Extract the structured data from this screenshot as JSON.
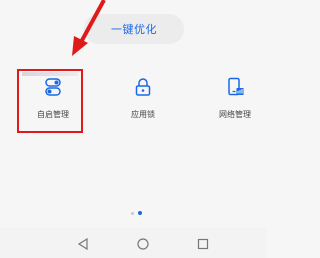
{
  "top": {
    "optimize_label": "一键优化"
  },
  "tiles": [
    {
      "label": "自启管理",
      "icon": "toggle-switches-icon"
    },
    {
      "label": "应用锁",
      "icon": "padlock-icon"
    },
    {
      "label": "网络管理",
      "icon": "phone-network-icon"
    }
  ],
  "colors": {
    "accent": "#1a68e6",
    "highlight": "#e01a1a",
    "background": "#f6f6f6"
  },
  "pager": {
    "total": 2,
    "active": 2
  }
}
